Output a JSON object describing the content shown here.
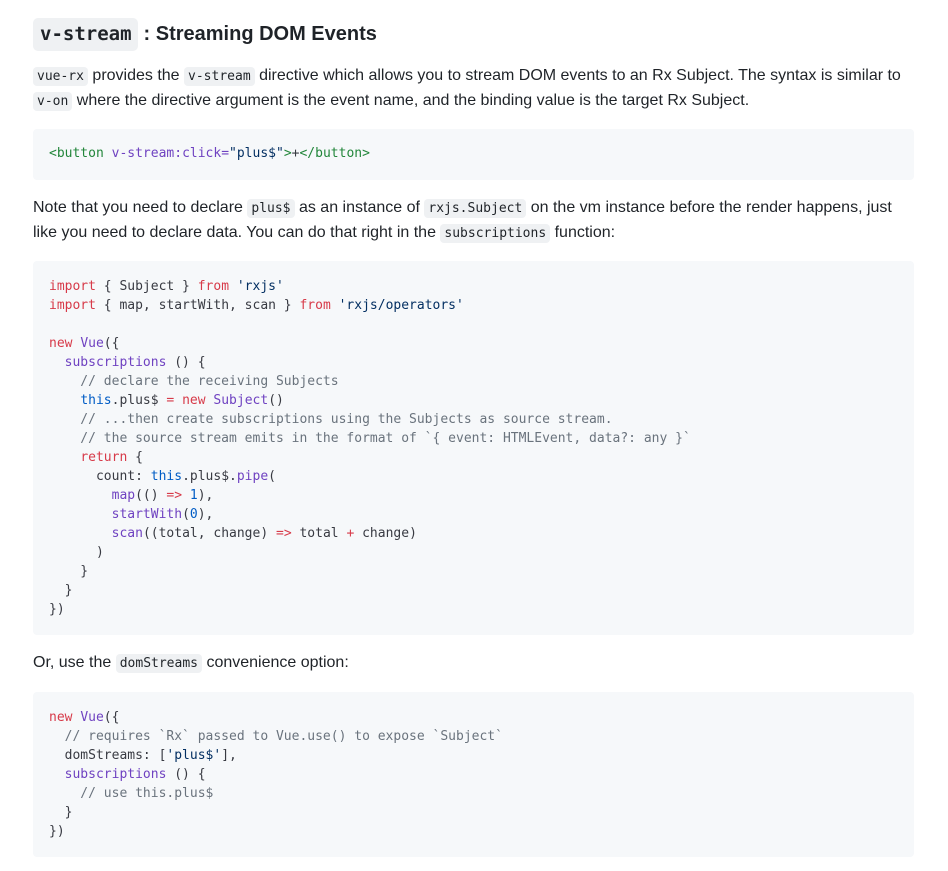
{
  "heading": {
    "code": "v-stream",
    "rest": " : Streaming DOM Events"
  },
  "para1": {
    "code1": "vue-rx",
    "t1": " provides the ",
    "code2": "v-stream",
    "t2": " directive which allows you to stream DOM events to an Rx Subject. The syntax is similar to ",
    "code3": "v-on",
    "t3": " where the directive argument is the event name, and the binding value is the target Rx Subject."
  },
  "code1": {
    "lines": [
      [
        [
          "tag",
          "<button "
        ],
        [
          "attr",
          "v-stream:click="
        ],
        [
          "str",
          "\"plus$\""
        ],
        [
          "tag",
          ">"
        ],
        [
          "plain",
          "+"
        ],
        [
          "tag",
          "</button>"
        ]
      ]
    ]
  },
  "para2": {
    "t1": "Note that you need to declare ",
    "code1": "plus$",
    "t2": " as an instance of ",
    "code2": "rxjs.Subject",
    "t3": " on the vm instance before the render happens, just like you need to declare data. You can do that right in the ",
    "code3": "subscriptions",
    "t4": " function:"
  },
  "code2": {
    "lines": [
      [
        [
          "kw",
          "import"
        ],
        [
          "plain",
          " { Subject } "
        ],
        [
          "kw",
          "from"
        ],
        [
          "plain",
          " "
        ],
        [
          "str",
          "'rxjs'"
        ]
      ],
      [
        [
          "kw",
          "import"
        ],
        [
          "plain",
          " { map, startWith, scan } "
        ],
        [
          "kw",
          "from"
        ],
        [
          "plain",
          " "
        ],
        [
          "str",
          "'rxjs/operators'"
        ]
      ],
      [
        [
          "plain",
          ""
        ]
      ],
      [
        [
          "kw",
          "new"
        ],
        [
          "plain",
          " "
        ],
        [
          "fn",
          "Vue"
        ],
        [
          "plain",
          "({"
        ]
      ],
      [
        [
          "plain",
          "  "
        ],
        [
          "fn",
          "subscriptions"
        ],
        [
          "plain",
          " () {"
        ]
      ],
      [
        [
          "cm",
          "    // declare the receiving Subjects"
        ]
      ],
      [
        [
          "plain",
          "    "
        ],
        [
          "this",
          "this"
        ],
        [
          "plain",
          ".plus$ "
        ],
        [
          "kw",
          "="
        ],
        [
          "plain",
          " "
        ],
        [
          "kw",
          "new"
        ],
        [
          "plain",
          " "
        ],
        [
          "fn",
          "Subject"
        ],
        [
          "plain",
          "()"
        ]
      ],
      [
        [
          "cm",
          "    // ...then create subscriptions using the Subjects as source stream."
        ]
      ],
      [
        [
          "cm",
          "    // the source stream emits in the format of `{ event: HTMLEvent, data?: any }`"
        ]
      ],
      [
        [
          "plain",
          "    "
        ],
        [
          "kw",
          "return"
        ],
        [
          "plain",
          " {"
        ]
      ],
      [
        [
          "plain",
          "      count: "
        ],
        [
          "this",
          "this"
        ],
        [
          "plain",
          ".plus$."
        ],
        [
          "fn",
          "pipe"
        ],
        [
          "plain",
          "("
        ]
      ],
      [
        [
          "plain",
          "        "
        ],
        [
          "fn",
          "map"
        ],
        [
          "plain",
          "(() "
        ],
        [
          "kw",
          "=>"
        ],
        [
          "plain",
          " "
        ],
        [
          "num",
          "1"
        ],
        [
          "plain",
          "),"
        ]
      ],
      [
        [
          "plain",
          "        "
        ],
        [
          "fn",
          "startWith"
        ],
        [
          "plain",
          "("
        ],
        [
          "num",
          "0"
        ],
        [
          "plain",
          "),"
        ]
      ],
      [
        [
          "plain",
          "        "
        ],
        [
          "fn",
          "scan"
        ],
        [
          "plain",
          "((total, change) "
        ],
        [
          "kw",
          "=>"
        ],
        [
          "plain",
          " total "
        ],
        [
          "kw",
          "+"
        ],
        [
          "plain",
          " change)"
        ]
      ],
      [
        [
          "plain",
          "      )"
        ]
      ],
      [
        [
          "plain",
          "    }"
        ]
      ],
      [
        [
          "plain",
          "  }"
        ]
      ],
      [
        [
          "plain",
          "})"
        ]
      ]
    ]
  },
  "para3": {
    "t1": "Or, use the ",
    "code1": "domStreams",
    "t2": " convenience option:"
  },
  "code3": {
    "lines": [
      [
        [
          "kw",
          "new"
        ],
        [
          "plain",
          " "
        ],
        [
          "fn",
          "Vue"
        ],
        [
          "plain",
          "({"
        ]
      ],
      [
        [
          "cm",
          "  // requires `Rx` passed to Vue.use() to expose `Subject`"
        ]
      ],
      [
        [
          "plain",
          "  domStreams: ["
        ],
        [
          "str",
          "'plus$'"
        ],
        [
          "plain",
          "],"
        ]
      ],
      [
        [
          "plain",
          "  "
        ],
        [
          "fn",
          "subscriptions"
        ],
        [
          "plain",
          " () {"
        ]
      ],
      [
        [
          "cm",
          "    // use this.plus$"
        ]
      ],
      [
        [
          "plain",
          "  }"
        ]
      ],
      [
        [
          "plain",
          "})"
        ]
      ]
    ]
  }
}
